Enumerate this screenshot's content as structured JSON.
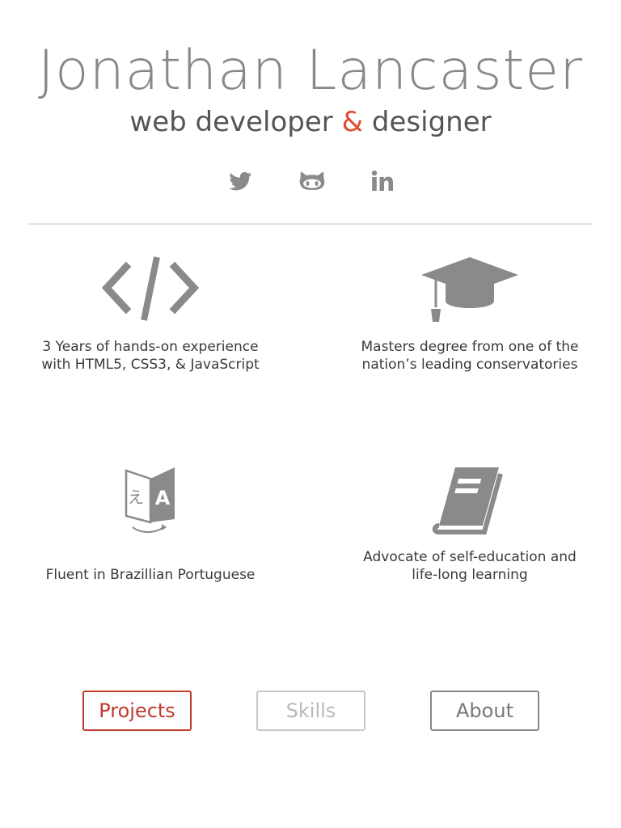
{
  "header": {
    "name": "Jonathan Lancaster",
    "tagline_part1": "web developer ",
    "tagline_amp": "&",
    "tagline_part2": " designer"
  },
  "social": [
    {
      "label": "Twitter",
      "icon": "twitter-icon"
    },
    {
      "label": "GitHub",
      "icon": "github-icon"
    },
    {
      "label": "LinkedIn",
      "icon": "linkedin-icon"
    }
  ],
  "features": [
    {
      "icon": "code-icon",
      "text": "3 Years of hands-on experience\nwith HTML5, CSS3, & JavaScript"
    },
    {
      "icon": "graduation-cap-icon",
      "text": "Masters degree from one of the\nnation’s leading conservatories"
    },
    {
      "icon": "translate-icon",
      "text": "Fluent in Brazillian Portuguese"
    },
    {
      "icon": "book-icon",
      "text": "Advocate of self-education and\nlife-long learning"
    }
  ],
  "nav": {
    "projects": "Projects",
    "skills": "Skills",
    "about": "About"
  },
  "colors": {
    "accent": "#e04a33",
    "projects_border": "#c0392b",
    "icon_gray": "#8a8a8a",
    "name_gray": "#888888"
  }
}
